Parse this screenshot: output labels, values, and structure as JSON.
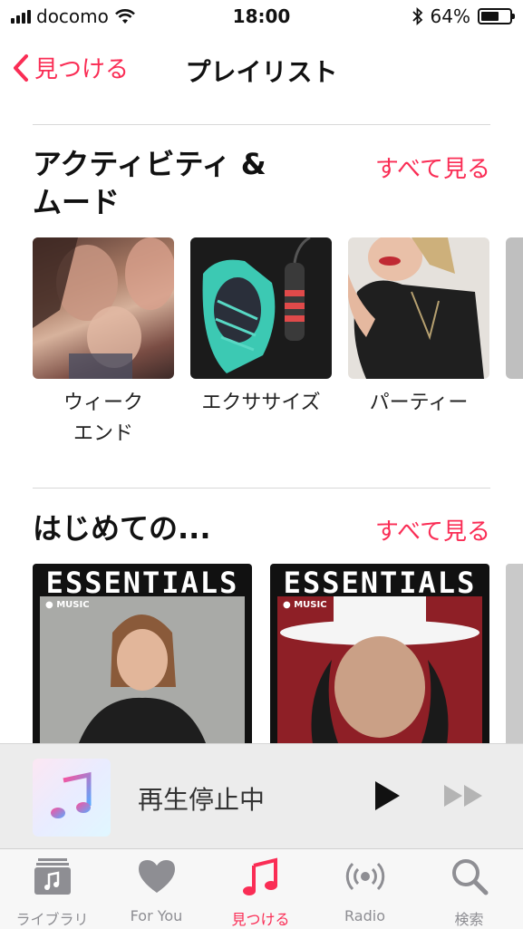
{
  "status_bar": {
    "carrier": "docomo",
    "time": "18:00",
    "battery_percent": "64%",
    "battery_level": 0.64
  },
  "nav": {
    "back_label": "見つける",
    "title": "プレイリスト"
  },
  "activity_section": {
    "title_line1": "アクティビティ &",
    "title_line2": "ムード",
    "see_all": "すべて見る",
    "tiles": [
      {
        "label_line1": "ウィーク",
        "label_line2": "エンド"
      },
      {
        "label_line1": "エクササイズ",
        "label_line2": ""
      },
      {
        "label_line1": "パーティー",
        "label_line2": ""
      }
    ]
  },
  "beginner_section": {
    "title": "はじめての...",
    "see_all": "すべて見る",
    "cards": [
      {
        "banner": "ESSENTIALS",
        "brand": "MUSIC"
      },
      {
        "banner": "ESSENTIALS",
        "brand": "MUSIC"
      }
    ]
  },
  "mini_player": {
    "status": "再生停止中"
  },
  "tab_bar": {
    "tabs": [
      {
        "label": "ライブラリ",
        "icon": "library-icon",
        "active": false
      },
      {
        "label": "For You",
        "icon": "heart-icon",
        "active": false
      },
      {
        "label": "見つける",
        "icon": "music-note-icon",
        "active": true
      },
      {
        "label": "Radio",
        "icon": "radio-icon",
        "active": false
      },
      {
        "label": "検索",
        "icon": "search-icon",
        "active": false
      }
    ]
  },
  "colors": {
    "accent": "#fa2d55",
    "tab_inactive": "#8e8e93"
  }
}
